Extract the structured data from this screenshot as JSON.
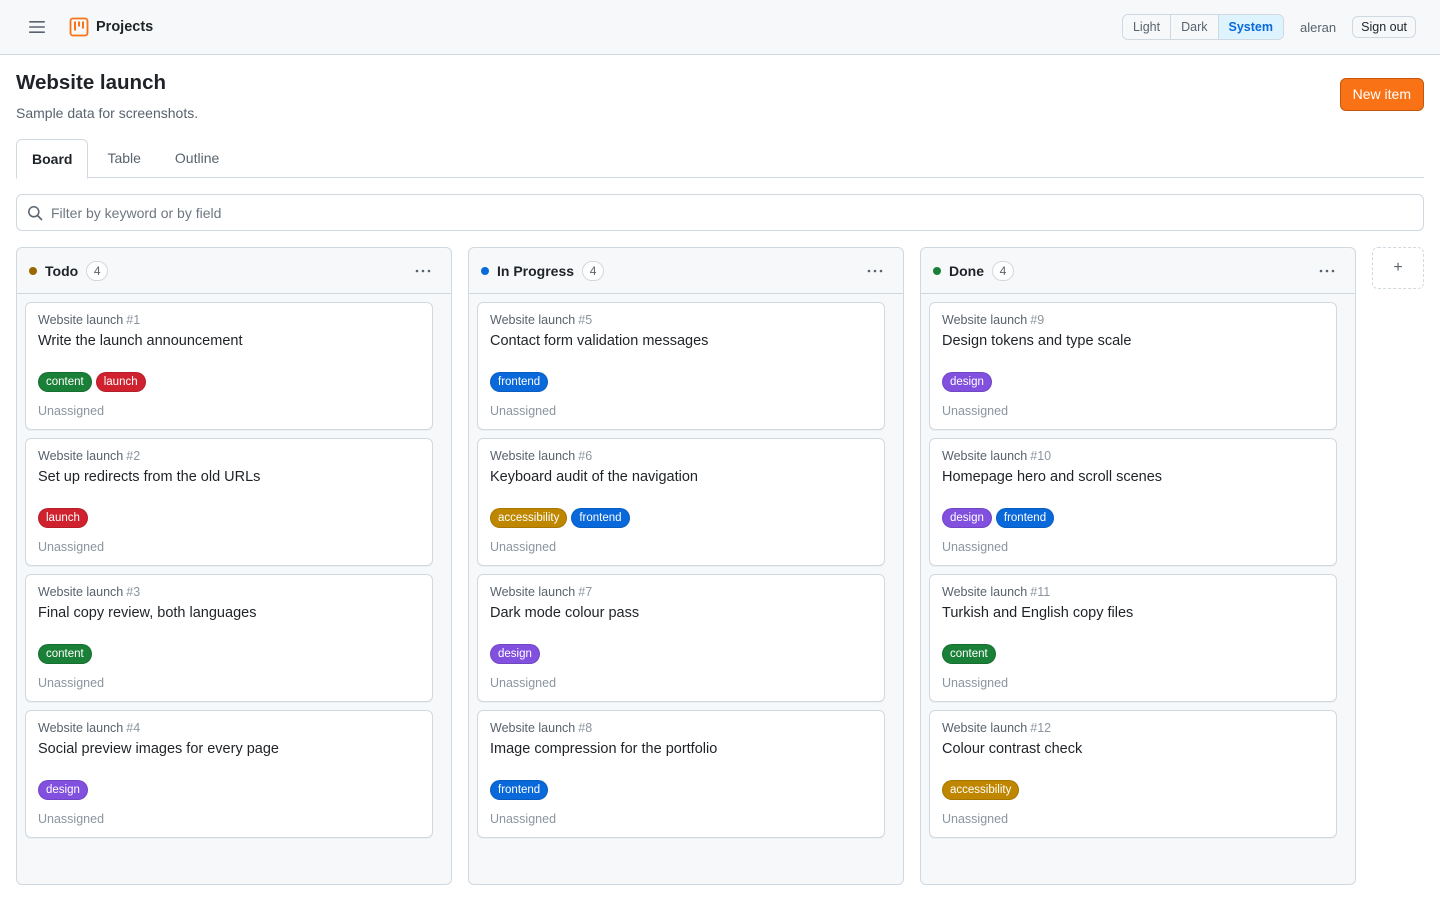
{
  "header": {
    "app_name": "Projects",
    "theme_options": [
      "Light",
      "Dark",
      "System"
    ],
    "theme_selected": "System",
    "username": "aleran",
    "signout_label": "Sign out"
  },
  "page": {
    "title": "Website launch",
    "subtitle": "Sample data for screenshots.",
    "new_item_label": "New item"
  },
  "tabs": [
    {
      "label": "Board",
      "active": true
    },
    {
      "label": "Table",
      "active": false
    },
    {
      "label": "Outline",
      "active": false
    }
  ],
  "filter": {
    "placeholder": "Filter by keyword or by field",
    "value": ""
  },
  "label_colors": {
    "content": "#1a7f37",
    "launch": "#cf222e",
    "frontend": "#0969da",
    "accessibility": "#bf8700",
    "design": "#8250df"
  },
  "columns": [
    {
      "name": "Todo",
      "count": "4",
      "dot_color": "#9a6700",
      "cards": [
        {
          "project": "Website launch",
          "number": "#1",
          "title": "Write the launch announcement",
          "labels": [
            "content",
            "launch"
          ],
          "assignee": "Unassigned"
        },
        {
          "project": "Website launch",
          "number": "#2",
          "title": "Set up redirects from the old URLs",
          "labels": [
            "launch"
          ],
          "assignee": "Unassigned"
        },
        {
          "project": "Website launch",
          "number": "#3",
          "title": "Final copy review, both languages",
          "labels": [
            "content"
          ],
          "assignee": "Unassigned"
        },
        {
          "project": "Website launch",
          "number": "#4",
          "title": "Social preview images for every page",
          "labels": [
            "design"
          ],
          "assignee": "Unassigned"
        }
      ]
    },
    {
      "name": "In Progress",
      "count": "4",
      "dot_color": "#0969da",
      "cards": [
        {
          "project": "Website launch",
          "number": "#5",
          "title": "Contact form validation messages",
          "labels": [
            "frontend"
          ],
          "assignee": "Unassigned"
        },
        {
          "project": "Website launch",
          "number": "#6",
          "title": "Keyboard audit of the navigation",
          "labels": [
            "accessibility",
            "frontend"
          ],
          "assignee": "Unassigned"
        },
        {
          "project": "Website launch",
          "number": "#7",
          "title": "Dark mode colour pass",
          "labels": [
            "design"
          ],
          "assignee": "Unassigned"
        },
        {
          "project": "Website launch",
          "number": "#8",
          "title": "Image compression for the portfolio",
          "labels": [
            "frontend"
          ],
          "assignee": "Unassigned"
        }
      ]
    },
    {
      "name": "Done",
      "count": "4",
      "dot_color": "#1a7f37",
      "cards": [
        {
          "project": "Website launch",
          "number": "#9",
          "title": "Design tokens and type scale",
          "labels": [
            "design"
          ],
          "assignee": "Unassigned"
        },
        {
          "project": "Website launch",
          "number": "#10",
          "title": "Homepage hero and scroll scenes",
          "labels": [
            "design",
            "frontend"
          ],
          "assignee": "Unassigned"
        },
        {
          "project": "Website launch",
          "number": "#11",
          "title": "Turkish and English copy files",
          "labels": [
            "content"
          ],
          "assignee": "Unassigned"
        },
        {
          "project": "Website launch",
          "number": "#12",
          "title": "Colour contrast check",
          "labels": [
            "accessibility"
          ],
          "assignee": "Unassigned"
        }
      ]
    }
  ],
  "add_column_label": "+",
  "icons": {
    "menu": "hamburger-menu-icon",
    "brand": "project-board-icon",
    "search": "search-icon",
    "more": "kebab-more-icon"
  }
}
